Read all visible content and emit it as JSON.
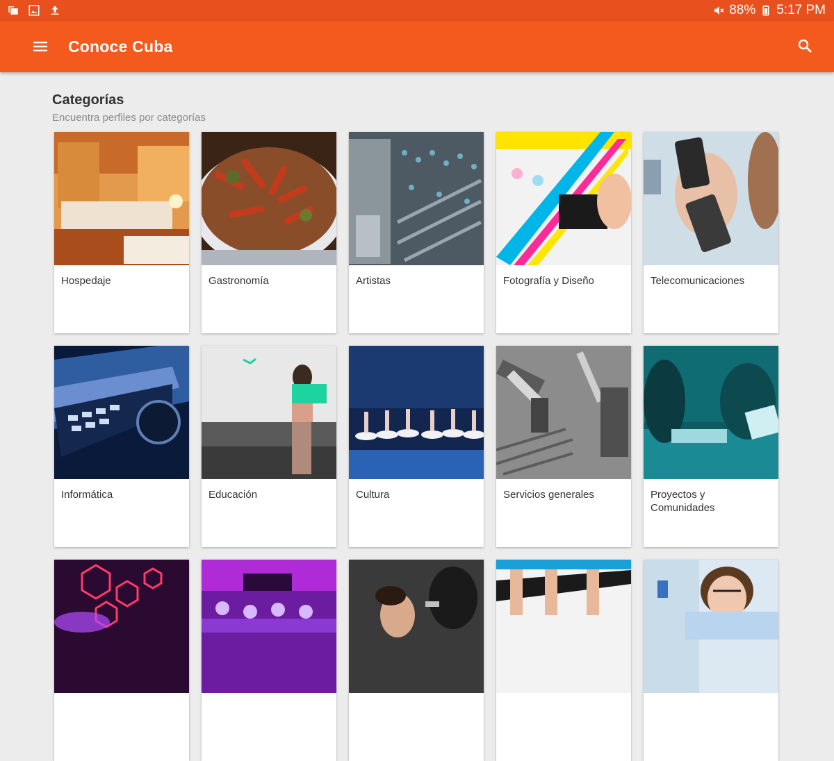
{
  "status_bar": {
    "battery": "88%",
    "time": "5:17 PM"
  },
  "app_bar": {
    "title": "Conoce Cuba"
  },
  "section": {
    "title": "Categorías",
    "subtitle": "Encuentra perfiles por categorías"
  },
  "categories": [
    {
      "label": "Hospedaje"
    },
    {
      "label": "Gastronomía"
    },
    {
      "label": "Artistas"
    },
    {
      "label": "Fotografía y Diseño"
    },
    {
      "label": "Telecomunicaciones"
    },
    {
      "label": "Informática"
    },
    {
      "label": "Educación"
    },
    {
      "label": "Cultura"
    },
    {
      "label": "Servicios generales"
    },
    {
      "label": "Proyectos y Comunidades"
    },
    {
      "label": ""
    },
    {
      "label": ""
    },
    {
      "label": ""
    },
    {
      "label": ""
    },
    {
      "label": ""
    }
  ],
  "colors": {
    "status_bar": "#e8501d",
    "app_bar": "#f4591e",
    "background": "#ececec"
  }
}
